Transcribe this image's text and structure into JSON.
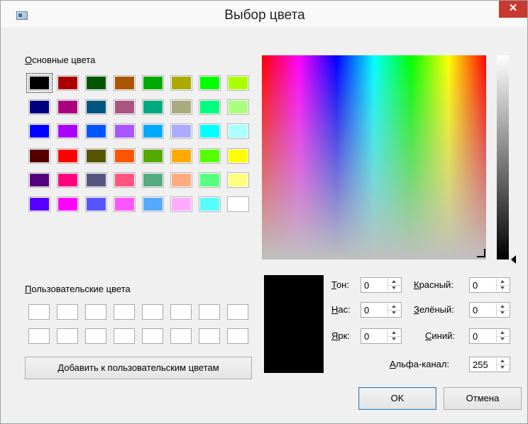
{
  "window": {
    "title": "Выбор цвета",
    "close_glyph": "✕",
    "icon": "dialog-app-icon"
  },
  "basic_colors": {
    "label_first": "О",
    "label_rest": "сновные цвета",
    "swatches": [
      "#000000",
      "#aa0000",
      "#005500",
      "#aa5500",
      "#00aa00",
      "#aaaa00",
      "#00ff00",
      "#aaff00",
      "#00007f",
      "#aa007f",
      "#00557f",
      "#aa557f",
      "#00aa7f",
      "#aaaa7f",
      "#00ff7f",
      "#aaff7f",
      "#0000ff",
      "#aa00ff",
      "#0055ff",
      "#aa55ff",
      "#00aaff",
      "#aaaaff",
      "#00ffff",
      "#aaffff",
      "#550000",
      "#ff0000",
      "#555500",
      "#ff5500",
      "#55aa00",
      "#ffaa00",
      "#55ff00",
      "#ffff00",
      "#55007f",
      "#ff007f",
      "#55557f",
      "#ff557f",
      "#55aa7f",
      "#ffaa7f",
      "#55ff7f",
      "#ffff7f",
      "#5500ff",
      "#ff00ff",
      "#5555ff",
      "#ff55ff",
      "#55aaff",
      "#ffaaff",
      "#55ffff",
      "#ffffff"
    ],
    "selected_index": 0
  },
  "custom_colors": {
    "label_first": "П",
    "label_rest": "ользовательские цвета",
    "count": 16
  },
  "add_custom_button": {
    "first": "Д",
    "rest": "обавить к пользовательским цветам"
  },
  "fields": {
    "hue": {
      "key": "Т",
      "rest": "он:",
      "value": "0"
    },
    "sat": {
      "key": "Н",
      "rest": "ас:",
      "value": "0"
    },
    "val": {
      "key": "Я",
      "rest": "рк:",
      "value": "0"
    },
    "red": {
      "key": "К",
      "rest": "расный:",
      "value": "0"
    },
    "green": {
      "key": "З",
      "rest": "елёный:",
      "value": "0"
    },
    "blue": {
      "key": "С",
      "rest": "иний:",
      "value": "0"
    },
    "alpha": {
      "key": "А",
      "rest": "льфа-канал:",
      "value": "255"
    }
  },
  "preview_color": "#000000",
  "buttons": {
    "ok": "OK",
    "cancel": "Отмена"
  },
  "colors": {
    "close_bg": "#c7392e",
    "titlebar_bg": "#f8f8f8",
    "dialog_bg": "#f0f0f0",
    "default_border": "#3c7fb1"
  }
}
